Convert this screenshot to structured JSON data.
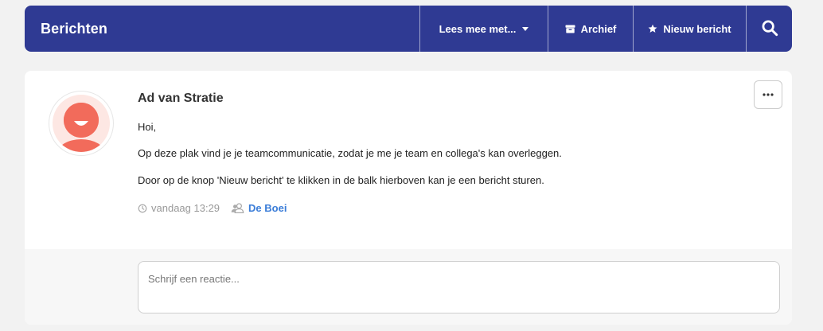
{
  "header": {
    "title": "Berichten",
    "read_along_label": "Lees mee met...",
    "archive_label": "Archief",
    "new_message_label": "Nieuw bericht",
    "icons": {
      "dropdown": "caret-down-icon",
      "archive": "archive-box-icon",
      "new": "star-icon",
      "search": "search-icon"
    }
  },
  "post": {
    "author": "Ad van Stratie",
    "lines": [
      "Hoi,",
      "Op deze plak vind je je teamcommunicatie, zodat je me je team en collega's kan overleggen.",
      "Door op de knop 'Nieuw bericht' te klikken in de balk hierboven kan je een bericht sturen."
    ],
    "timestamp": "vandaag 13:29",
    "team": "De Boei",
    "icons": {
      "avatar": "smiley-avatar-icon",
      "clock": "clock-icon",
      "team": "users-icon",
      "more": "ellipsis-icon"
    }
  },
  "reply": {
    "placeholder": "Schrijf een reactie..."
  },
  "colors": {
    "header_bg": "#2f3a93",
    "avatar_face": "#f26b5b",
    "link": "#3b7dd8"
  }
}
